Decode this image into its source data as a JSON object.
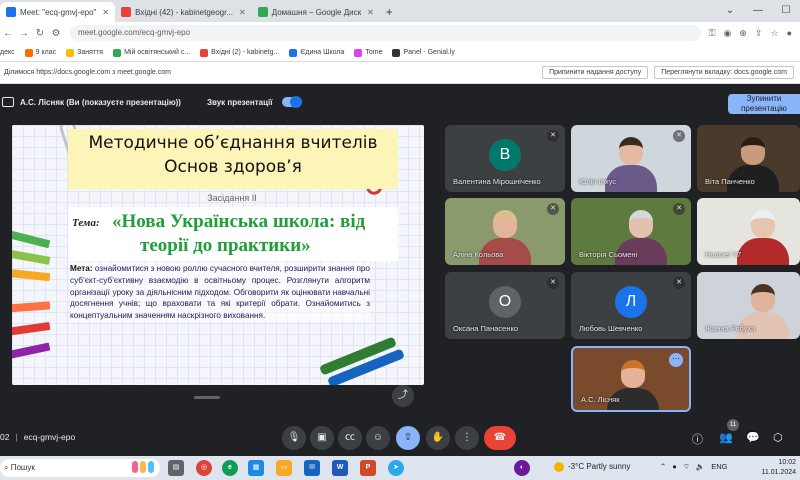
{
  "browser": {
    "tabs": [
      {
        "title": "Meet: \"ecq-gmvj-epo\"",
        "color": "#1a73e8",
        "active": true
      },
      {
        "title": "Вхідні (42) - kabinetgeogr...",
        "color": "#ea4335",
        "active": false
      },
      {
        "title": "Домашня – Google Диск",
        "color": "#34a853",
        "active": false
      }
    ],
    "new_tab": "+",
    "url": "meet.google.com/ecq-gmvj-epo",
    "bookmarks": [
      {
        "label": "декс",
        "color": "#ffffff"
      },
      {
        "label": "9 клас",
        "color": "#ff6d00"
      },
      {
        "label": "Заняття",
        "color": "#fbbc04"
      },
      {
        "label": "Мій освітянський с...",
        "color": "#34a853"
      },
      {
        "label": "Вхідні (2) - kabinetg...",
        "color": "#ea4335"
      },
      {
        "label": "Єдина Школа",
        "color": "#1a73e8"
      },
      {
        "label": "Tome",
        "color": "#e040fb"
      },
      {
        "label": "Panel - Genial.ly",
        "color": "#333333"
      }
    ],
    "share_notice": "Ділимося https://docs.google.com з meet.google.com",
    "share_buttons": [
      "Припинити надання доступу",
      "Переглянути вкладку: docs.google.com"
    ]
  },
  "meet": {
    "presenter": "А.С. Лісняк (Ви (показуєте презентацію))",
    "audio_label": "Звук презентації",
    "stop_button": "Зупинити презентацію",
    "meeting_code_prefix": "02",
    "meeting_code": "ecq-gmvj-epo",
    "participants_count": "11"
  },
  "slide": {
    "title_line1": "Методичне об’єднання вчителів",
    "title_line2": "Основ здоров’я",
    "session": "Засідання ІІ",
    "topic_label": "Тема:",
    "topic_line1": "«Нова Українська школа: від",
    "topic_line2": "теорії до практики»",
    "goal_label": "Мета:",
    "goal_text": " ознайомитися з новою роллю сучасного вчителя, розширити знання про суб’єкт-суб’єктивну взаємодію в освітньому процес. Розглянути алгоритм організації уроку за діяльнісним підходом. Обговорити як оцінювати навчальні досягнення учнів; що враховати та які критерії обрати. Ознайомитись з концептуальним значенням наскрізного виховання."
  },
  "participants": [
    {
      "name": "Валентина Мірошніченко",
      "type": "avatar",
      "letter": "В",
      "color": "#00796b"
    },
    {
      "name": "Юлія Ілхус",
      "type": "video",
      "bg": "#cfd6dc",
      "skin": "#e3b9a2",
      "hair": "#3b2a20",
      "shirt": "#6a5a8a"
    },
    {
      "name": "Віта Панченко",
      "type": "video",
      "bg": "#4a3a2c",
      "skin": "#c99b7c",
      "hair": "#2a1d14",
      "shirt": "#1f1f1f"
    },
    {
      "name": "Аліна Кольова",
      "type": "video",
      "bg": "#8a9a6c",
      "skin": "#e0b59a",
      "hair": "#d9c08a",
      "shirt": "#a64a4a"
    },
    {
      "name": "Вікторія Сьомені",
      "type": "video",
      "bg": "#5f7a3e",
      "skin": "#e2c1ad",
      "hair": "#d8d8d8",
      "shirt": "#6b3b5c"
    },
    {
      "name": "Huawei Y7",
      "type": "video",
      "bg": "#e6e4df",
      "skin": "#e6c5b0",
      "hair": "#efefef",
      "shirt": "#b22a2a"
    },
    {
      "name": "Оксана Панасенко",
      "type": "avatar",
      "letter": "О",
      "color": "#5f6368"
    },
    {
      "name": "Любовь Шевченко",
      "type": "avatar",
      "letter": "Л",
      "color": "#1a73e8"
    },
    {
      "name": "Жанна Рябуха",
      "type": "video",
      "bg": "#cdd3d8",
      "skin": "#dfb49c",
      "hair": "#4a3322",
      "shirt": "#e3c3b3"
    },
    {
      "name": "А.С. Лісняк",
      "type": "video",
      "bg": "#7a4a2c",
      "skin": "#e6b297",
      "hair": "#c9742a",
      "shirt": "#2c2c2c"
    }
  ],
  "taskbar": {
    "search_label": "Пошук",
    "weather": "-3°C Partly sunny",
    "lang": "ENG",
    "time": "10:02",
    "date": "11.01.2024"
  }
}
